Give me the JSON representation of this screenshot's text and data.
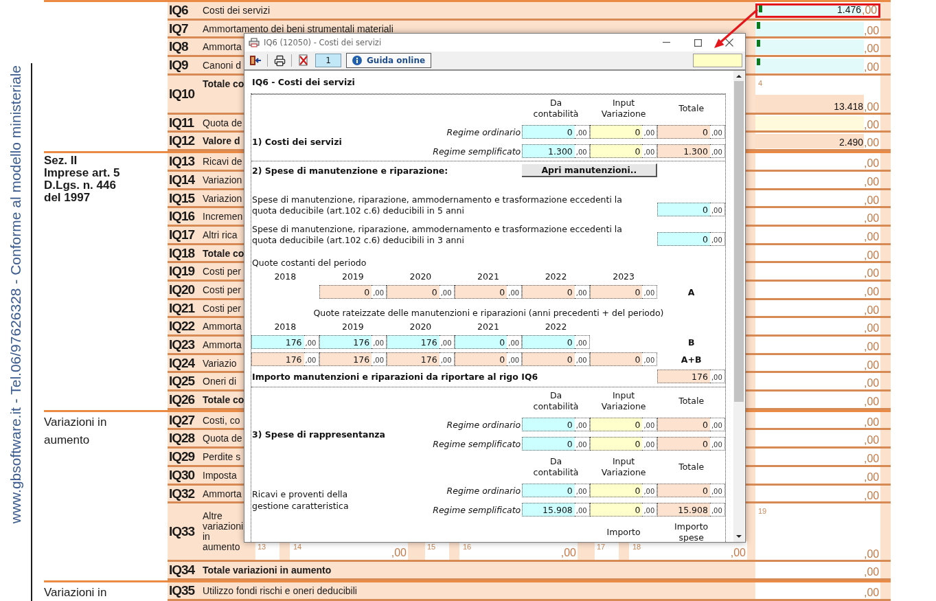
{
  "side_note": "www.gbsoftware.it - Tel.06/97626328 - Conforme al modello ministeriale",
  "form": {
    "groups": [
      {
        "rows": [
          {
            "code": "IQ6",
            "label": "Costi dei servizi",
            "bold": false,
            "kind": "standard",
            "field": {
              "kind": "linked",
              "value": "1.476",
              "decimals": ",00",
              "flag": true,
              "highlighted": true
            }
          },
          {
            "code": "IQ7",
            "label": "Ammortamento dei beni strumentali materiali",
            "bold": false,
            "kind": "standard",
            "field": {
              "kind": "linked",
              "decimals": ",00",
              "flag": true,
              "highlighted": false
            }
          },
          {
            "code": "IQ8",
            "label": "Ammorta",
            "bold": false,
            "kind": "standard",
            "field": {
              "kind": "linked",
              "decimals": ",00",
              "flag": true,
              "highlighted": false
            }
          },
          {
            "code": "IQ9",
            "label": "Canoni d",
            "bold": false,
            "kind": "standard",
            "field": {
              "kind": "linked",
              "decimals": ",00",
              "flag": true,
              "highlighted": false
            }
          },
          {
            "code": "IQ10",
            "label": "Totale co",
            "bold": true,
            "kind": "noted",
            "field": {
              "kind": "total",
              "note": "4",
              "value": "13.418",
              "decimals": ",00",
              "flag": false,
              "highlighted": false
            }
          },
          {
            "code": "IQ11",
            "label": "Quota de",
            "bold": false,
            "kind": "standard",
            "field": {
              "kind": "manual",
              "decimals": ",00",
              "flag": false,
              "highlighted": false
            }
          },
          {
            "code": "IQ12",
            "label": "Valore d",
            "bold": true,
            "kind": "standard",
            "field": {
              "kind": "total",
              "value": "2.490",
              "decimals": ",00",
              "flag": false,
              "highlighted": false
            }
          }
        ]
      },
      {
        "lines": [
          "Sez. II",
          "Imprese art. 5",
          "D.Lgs. n. 446",
          "del 1997"
        ],
        "bold": true,
        "rows": [
          {
            "code": "IQ13",
            "label": "Ricavi de",
            "bold": false,
            "kind": "standard",
            "field": {
              "kind": "plain",
              "decimals": ",00",
              "flag": false,
              "highlighted": false
            }
          },
          {
            "code": "IQ14",
            "label": "Variazion",
            "bold": false,
            "kind": "standard",
            "field": {
              "kind": "plain",
              "decimals": ",00",
              "flag": false,
              "highlighted": false
            }
          },
          {
            "code": "IQ15",
            "label": "Variazion",
            "bold": false,
            "kind": "standard",
            "field": {
              "kind": "plain",
              "decimals": ",00",
              "flag": false,
              "highlighted": false
            }
          },
          {
            "code": "IQ16",
            "label": "Incremen",
            "bold": false,
            "kind": "standard",
            "field": {
              "kind": "plain",
              "decimals": ",00",
              "flag": false,
              "highlighted": false
            }
          },
          {
            "code": "IQ17",
            "label": "Altri rica",
            "bold": false,
            "kind": "standard",
            "field": {
              "kind": "plain",
              "decimals": ",00",
              "flag": false,
              "highlighted": false
            }
          },
          {
            "code": "IQ18",
            "label": "Totale co",
            "bold": true,
            "kind": "standard",
            "field": {
              "kind": "plain",
              "decimals": ",00",
              "flag": false,
              "highlighted": false
            }
          },
          {
            "code": "IQ19",
            "label": "Costi per",
            "bold": false,
            "kind": "standard",
            "field": {
              "kind": "plain",
              "decimals": ",00",
              "flag": false,
              "highlighted": false
            }
          },
          {
            "code": "IQ20",
            "label": "Costi per",
            "bold": false,
            "kind": "standard",
            "field": {
              "kind": "plain",
              "decimals": ",00",
              "flag": false,
              "highlighted": false
            }
          },
          {
            "code": "IQ21",
            "label": "Costi per",
            "bold": false,
            "kind": "standard",
            "field": {
              "kind": "plain",
              "decimals": ",00",
              "flag": false,
              "highlighted": false
            }
          },
          {
            "code": "IQ22",
            "label": "Ammorta",
            "bold": false,
            "kind": "standard",
            "field": {
              "kind": "plain",
              "decimals": ",00",
              "flag": false,
              "highlighted": false
            }
          },
          {
            "code": "IQ23",
            "label": "Ammorta",
            "bold": false,
            "kind": "standard",
            "field": {
              "kind": "plain",
              "decimals": ",00",
              "flag": false,
              "highlighted": false
            }
          },
          {
            "code": "IQ24",
            "label": "Variazio",
            "bold": false,
            "kind": "standard",
            "field": {
              "kind": "plain",
              "decimals": ",00",
              "flag": false,
              "highlighted": false
            }
          },
          {
            "code": "IQ25",
            "label": "Oneri di",
            "bold": false,
            "kind": "standard",
            "field": {
              "kind": "plain",
              "decimals": ",00",
              "flag": false,
              "highlighted": false
            }
          },
          {
            "code": "IQ26",
            "label": "Totale co",
            "bold": true,
            "kind": "standard",
            "field": {
              "kind": "plain",
              "decimals": ",00",
              "flag": false,
              "highlighted": false
            }
          }
        ]
      },
      {
        "lines": [
          "Variazioni in",
          "aumento"
        ],
        "bold": false,
        "rows": [
          {
            "code": "IQ27",
            "label": "Costi, co",
            "bold": false,
            "kind": "standard",
            "field": {
              "kind": "plain",
              "decimals": ",00",
              "flag": false,
              "highlighted": false
            }
          },
          {
            "code": "IQ28",
            "label": "Quota de",
            "bold": false,
            "kind": "standard",
            "field": {
              "kind": "plain",
              "decimals": ",00",
              "flag": false,
              "highlighted": false
            }
          },
          {
            "code": "IQ29",
            "label": "Perdite s",
            "bold": false,
            "kind": "standard",
            "field": {
              "kind": "plain",
              "decimals": ",00",
              "flag": false,
              "highlighted": false
            }
          },
          {
            "code": "IQ30",
            "label": "Imposta",
            "bold": false,
            "kind": "standard",
            "field": {
              "kind": "plain",
              "decimals": ",00",
              "flag": false,
              "highlighted": false
            }
          },
          {
            "code": "IQ32",
            "label": "Ammorta",
            "bold": false,
            "kind": "standard",
            "field": {
              "kind": "plain",
              "decimals": ",00",
              "flag": false,
              "highlighted": false
            }
          },
          {
            "code": "IQ33",
            "label": "Altre variazioni in aumento",
            "bold": false,
            "kind": "split",
            "subcells": [
              {
                "number": "13"
              },
              {
                "number": "14",
                "decimals": ",00"
              },
              {
                "number": "15"
              },
              {
                "number": "16",
                "decimals": ",00"
              },
              {
                "number": "17"
              },
              {
                "number": "18",
                "decimals": ",00"
              }
            ],
            "field": {
              "kind": "plain",
              "note": "19",
              "decimals": ",00",
              "flag": false,
              "highlighted": false
            }
          },
          {
            "code": "IQ34",
            "label": "Totale variazioni in aumento",
            "bold": true,
            "kind": "standard",
            "field": {
              "kind": "plain",
              "decimals": ",00",
              "flag": false,
              "highlighted": false
            }
          }
        ]
      },
      {
        "lines": [
          "Variazioni in"
        ],
        "bold": false,
        "rows": [
          {
            "code": "IQ35",
            "label": "Utilizzo fondi rischi e oneri deducibili",
            "bold": false,
            "kind": "standard",
            "field": {
              "kind": "plain",
              "decimals": ",00",
              "flag": false,
              "highlighted": false
            }
          }
        ]
      }
    ]
  },
  "dialog": {
    "title": "IQ6 (12050) - Costi dei servizi",
    "page_number": "1",
    "help_button": "Guida online",
    "heading": "IQ6 - Costi dei servizi",
    "sections": [
      {
        "kind": "regime",
        "title": "1) Costi dei servizi",
        "bold": true,
        "columns": [
          {
            "label": "Da contabilità",
            "kind": "accounting"
          },
          {
            "label": "Input Variazione",
            "kind": "input"
          },
          {
            "label": "Totale",
            "kind": "total"
          }
        ],
        "rows": [
          {
            "label": "Regime ordinario",
            "cells": [
              {
                "value": "0",
                "decimals": ",00"
              },
              {
                "value": "0",
                "decimals": ",00"
              },
              {
                "value": "0",
                "decimals": ",00"
              }
            ]
          },
          {
            "label": "Regime semplificato",
            "cells": [
              {
                "value": "1.300",
                "decimals": ",00"
              },
              {
                "value": "0",
                "decimals": ",00"
              },
              {
                "value": "1.300",
                "decimals": ",00"
              }
            ]
          }
        ]
      },
      {
        "kind": "maintenance",
        "title": "2) Spese di manutenzione e riparazione:",
        "button": "Apri manutenzioni..",
        "deferred": [
          {
            "text": "Spese di manutenzione, riparazione, ammodernamento e trasformazione eccedenti la quota deducibile (art.102 c.6) deducibili in 5 anni",
            "cell": {
              "value": "0",
              "decimals": ",00"
            }
          },
          {
            "text": "Spese di manutenzione, riparazione, ammodernamento e trasformazione eccedenti la quota deducibile (art.102 c.6) deducibili in 3 anni",
            "cell": {
              "value": "0",
              "decimals": ",00"
            }
          }
        ],
        "blocks": [
          {
            "caption": "Quote costanti del periodo",
            "years": [
              "2018",
              "2019",
              "2020",
              "2021",
              "2022",
              "2023"
            ],
            "rows": [
              {
                "label": "A",
                "kind": "total",
                "cells": [
                  {
                    "value": "0",
                    "decimals": ",00"
                  },
                  {
                    "value": "0",
                    "decimals": ",00"
                  },
                  {
                    "value": "0",
                    "decimals": ",00"
                  },
                  {
                    "value": "0",
                    "decimals": ",00"
                  },
                  {
                    "value": "0",
                    "decimals": ",00"
                  }
                ]
              }
            ]
          },
          {
            "caption": "Quote rateizzate delle manutenzioni e riparazioni (anni precedenti + del periodo)",
            "years": [
              "2018",
              "2019",
              "2020",
              "2021",
              "2022"
            ],
            "rows": [
              {
                "label": "B",
                "kind": "accounting",
                "cells": [
                  {
                    "value": "176",
                    "decimals": ",00"
                  },
                  {
                    "value": "176",
                    "decimals": ",00"
                  },
                  {
                    "value": "176",
                    "decimals": ",00"
                  },
                  {
                    "value": "0",
                    "decimals": ",00"
                  },
                  {
                    "value": "0",
                    "decimals": ",00"
                  }
                ]
              },
              {
                "label": "A+B",
                "kind": "total",
                "cells": [
                  {
                    "value": "176",
                    "decimals": ",00"
                  },
                  {
                    "value": "176",
                    "decimals": ",00"
                  },
                  {
                    "value": "176",
                    "decimals": ",00"
                  },
                  {
                    "value": "0",
                    "decimals": ",00"
                  },
                  {
                    "value": "0",
                    "decimals": ",00"
                  },
                  {
                    "value": "0",
                    "decimals": ",00"
                  }
                ]
              }
            ]
          }
        ],
        "result": {
          "label": "Importo manutenzioni e riparazioni da riportare al rigo IQ6",
          "cell": {
            "value": "176",
            "decimals": ",00"
          }
        }
      },
      {
        "kind": "regime",
        "title": "3) Spese di rappresentanza",
        "bold": true,
        "columns": [
          {
            "label": "Da contabilità",
            "kind": "accounting"
          },
          {
            "label": "Input Variazione",
            "kind": "input"
          },
          {
            "label": "Totale",
            "kind": "total"
          }
        ],
        "rows": [
          {
            "label": "Regime ordinario",
            "cells": [
              {
                "value": "0",
                "decimals": ",00"
              },
              {
                "value": "0",
                "decimals": ",00"
              },
              {
                "value": "0",
                "decimals": ",00"
              }
            ]
          },
          {
            "label": "Regime semplificato",
            "cells": [
              {
                "value": "0",
                "decimals": ",00"
              },
              {
                "value": "0",
                "decimals": ",00"
              },
              {
                "value": "0",
                "decimals": ",00"
              }
            ]
          }
        ]
      },
      {
        "kind": "regime",
        "title": "Ricavi e proventi della gestione caratteristica",
        "bold": false,
        "columns": [
          {
            "label": "Da contabilità",
            "kind": "accounting"
          },
          {
            "label": "Input Variazione",
            "kind": "input"
          },
          {
            "label": "Totale",
            "kind": "total"
          }
        ],
        "rows": [
          {
            "label": "Regime ordinario",
            "cells": [
              {
                "value": "0",
                "decimals": ",00"
              },
              {
                "value": "0",
                "decimals": ",00"
              },
              {
                "value": "0",
                "decimals": ",00"
              }
            ]
          },
          {
            "label": "Regime semplificato",
            "cells": [
              {
                "value": "15.908",
                "decimals": ",00"
              },
              {
                "value": "0",
                "decimals": ",00"
              },
              {
                "value": "15.908",
                "decimals": ",00"
              }
            ]
          }
        ]
      },
      {
        "kind": "headers",
        "labels": [
          "Importo",
          "Importo spese"
        ]
      }
    ]
  }
}
